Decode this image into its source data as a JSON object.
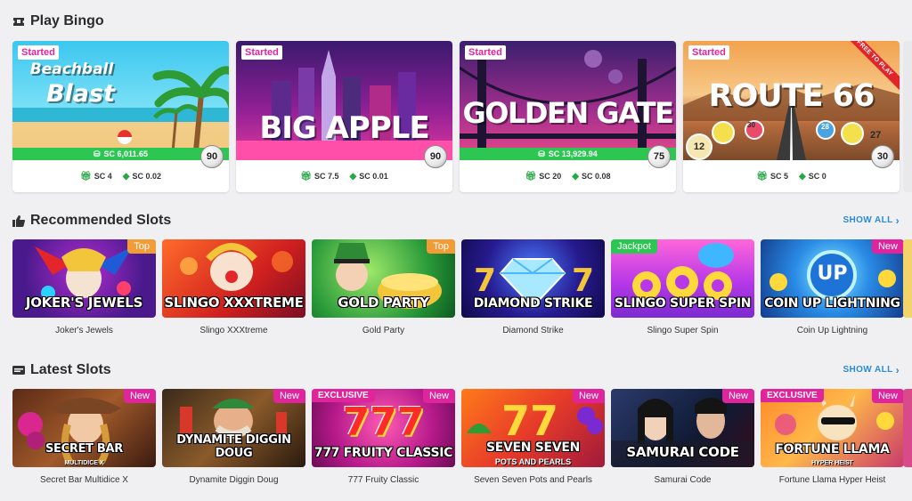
{
  "bingo": {
    "title": "Play Bingo",
    "cards": [
      {
        "title_line1": "Beachball",
        "title_line2": "Blast",
        "status": "Started",
        "jackpot": "SC 6,011.65",
        "balls": "90",
        "entry": "SC 4",
        "prize": "SC 0.02"
      },
      {
        "title_line1": "BIG APPLE",
        "status": "Started",
        "jackpot": "",
        "balls": "90",
        "entry": "SC 7.5",
        "prize": "SC 0.01"
      },
      {
        "title_line1": "GOLDEN GATE",
        "status": "Started",
        "jackpot": "SC 13,929.94",
        "balls": "75",
        "entry": "SC 20",
        "prize": "SC 0.08"
      },
      {
        "title_line1": "ROUTE 66",
        "status": "Started",
        "ribbon": "FREE TO PLAY",
        "jackpot": "",
        "balls": "30",
        "entry": "SC 5",
        "prize": "SC 0",
        "ball_numbers": [
          "12",
          "30",
          "28",
          "27"
        ]
      }
    ]
  },
  "recommended": {
    "title": "Recommended Slots",
    "show_all": "SHOW ALL",
    "items": [
      {
        "name": "Joker's Jewels",
        "art": "JOKER'S JEWELS",
        "badge": "Top"
      },
      {
        "name": "Slingo XXXtreme",
        "art": "SLINGO XXXTREME",
        "badge": ""
      },
      {
        "name": "Gold Party",
        "art": "GOLD PARTY",
        "badge": "Top"
      },
      {
        "name": "Diamond Strike",
        "art": "DIAMOND STRIKE",
        "badge": ""
      },
      {
        "name": "Slingo Super Spin",
        "art": "SLINGO SUPER SPIN",
        "badge": "Jackpot"
      },
      {
        "name": "Coin Up Lightning",
        "art": "COIN UP LIGHTNING",
        "art_top": "UP",
        "badge": "New"
      }
    ]
  },
  "latest": {
    "title": "Latest Slots",
    "show_all": "SHOW ALL",
    "items": [
      {
        "name": "Secret Bar Multidice X",
        "art": "SECRET BAR",
        "art_sub": "MULTIDICE X",
        "badge": "New"
      },
      {
        "name": "Dynamite Diggin Doug",
        "art": "DYNAMITE DIGGIN DOUG",
        "badge": "New"
      },
      {
        "name": "777 Fruity Classic",
        "art": "777 FRUITY CLASSIC",
        "art_top": "777",
        "badge": "New",
        "exclusive": "EXCLUSIVE"
      },
      {
        "name": "Seven Seven Pots and Pearls",
        "art": "SEVEN SEVEN",
        "art_sub": "POTS AND PEARLS",
        "badge": "New"
      },
      {
        "name": "Samurai Code",
        "art": "SAMURAI CODE",
        "badge": "New"
      },
      {
        "name": "Fortune Llama Hyper Heist",
        "art": "FORTUNE LLAMA",
        "art_sub": "HYPER HEIST",
        "badge": "New",
        "exclusive": "EXCLUSIVE"
      }
    ]
  },
  "colors": {
    "accent_pink": "#e0249c",
    "accent_green": "#2dc653",
    "link_blue": "#2a8bd6",
    "top_orange": "#f39b35"
  },
  "icons": {
    "bingo": "ticket-icon",
    "recommended": "thumbs-up-icon",
    "latest": "new-icon",
    "entry": "gift-icon",
    "prize": "price-tag-icon",
    "jackpot": "coins-icon"
  }
}
